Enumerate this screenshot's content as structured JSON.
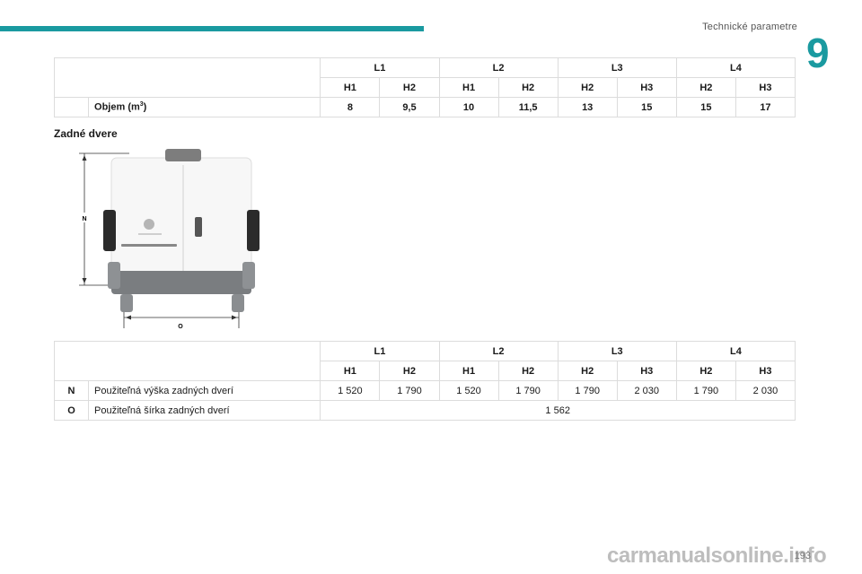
{
  "header": {
    "section_title": "Technické parametre",
    "chapter_number": "9"
  },
  "volume_table": {
    "lengths": [
      "L1",
      "L2",
      "L3",
      "L4"
    ],
    "heights": [
      "H1",
      "H2",
      "H1",
      "H2",
      "H2",
      "H3",
      "H2",
      "H3"
    ],
    "row_label": "Objem (m",
    "row_label_sup": "3",
    "row_label_end": ")",
    "values": [
      "8",
      "9,5",
      "10",
      "11,5",
      "13",
      "15",
      "15",
      "17"
    ]
  },
  "subheading": "Zadné dvere",
  "figure": {
    "label_height": "N",
    "label_width": "O"
  },
  "doors_table": {
    "lengths": [
      "L1",
      "L2",
      "L3",
      "L4"
    ],
    "heights": [
      "H1",
      "H2",
      "H1",
      "H2",
      "H2",
      "H3",
      "H2",
      "H3"
    ],
    "row_n": {
      "key": "N",
      "label": "Použiteľná výška zadných dverí",
      "values": [
        "1 520",
        "1 790",
        "1 520",
        "1 790",
        "1 790",
        "2 030",
        "1 790",
        "2 030"
      ]
    },
    "row_o": {
      "key": "O",
      "label": "Použiteľná šírka zadných dverí",
      "value": "1 562"
    }
  },
  "footer": {
    "page_number": "193",
    "watermark": "carmanualsonline.info"
  },
  "colors": {
    "accent": "#1a9aa0"
  }
}
